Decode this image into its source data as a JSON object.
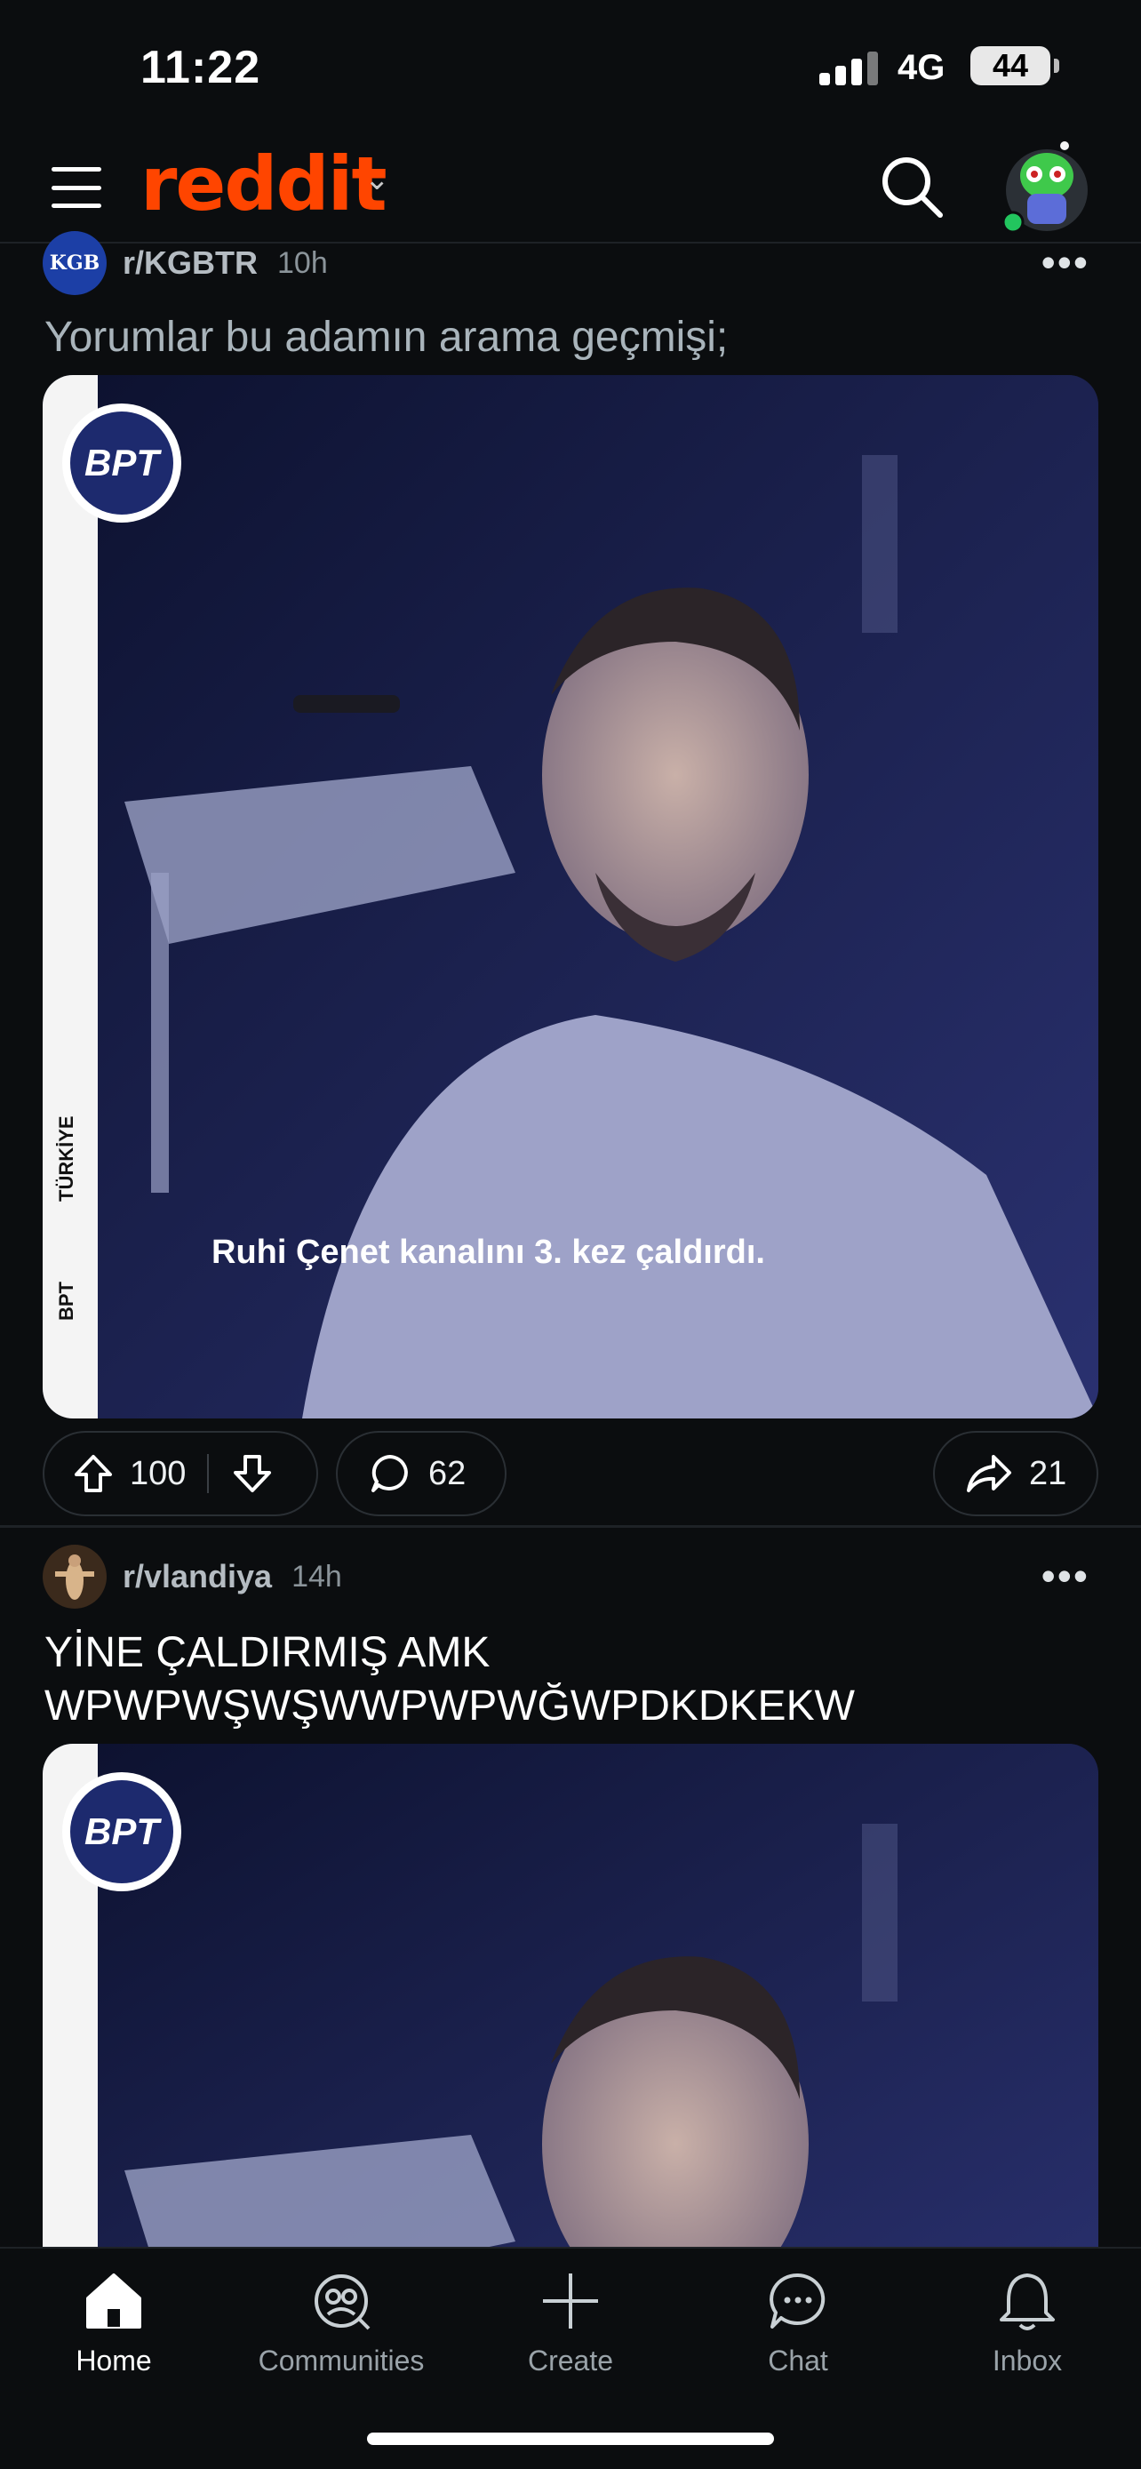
{
  "status_bar": {
    "time": "11:22",
    "network": "4G",
    "battery": "44"
  },
  "header": {
    "logo": "reddit"
  },
  "posts": [
    {
      "subreddit": "r/KGBTR",
      "subreddit_icon_text": "KGB",
      "age": "10h",
      "title": "Yorumlar bu adamın arama geçmişi;",
      "image": {
        "badge": "BPT",
        "strip_brand": "BPT",
        "strip_country": "TÜRKİYE",
        "caption": "Ruhi Çenet kanalını 3. kez çaldırdı."
      },
      "upvotes": "100",
      "comments": "62",
      "shares": "21"
    },
    {
      "subreddit": "r/vlandiya",
      "age": "14h",
      "title_line1": "YİNE ÇALDIRMIŞ AMK",
      "title_line2": "WPWPWŞWŞWWPWPWĞWPDKDKEKW",
      "image": {
        "badge": "BPT"
      }
    }
  ],
  "bottom_nav": [
    {
      "label": "Home",
      "icon": "home-icon",
      "active": true
    },
    {
      "label": "Communities",
      "icon": "communities-icon"
    },
    {
      "label": "Create",
      "icon": "plus-icon"
    },
    {
      "label": "Chat",
      "icon": "chat-icon"
    },
    {
      "label": "Inbox",
      "icon": "bell-icon"
    }
  ],
  "colors": {
    "brand": "#ff4500",
    "background": "#0b0d0f",
    "image_bg": "#15193a"
  }
}
